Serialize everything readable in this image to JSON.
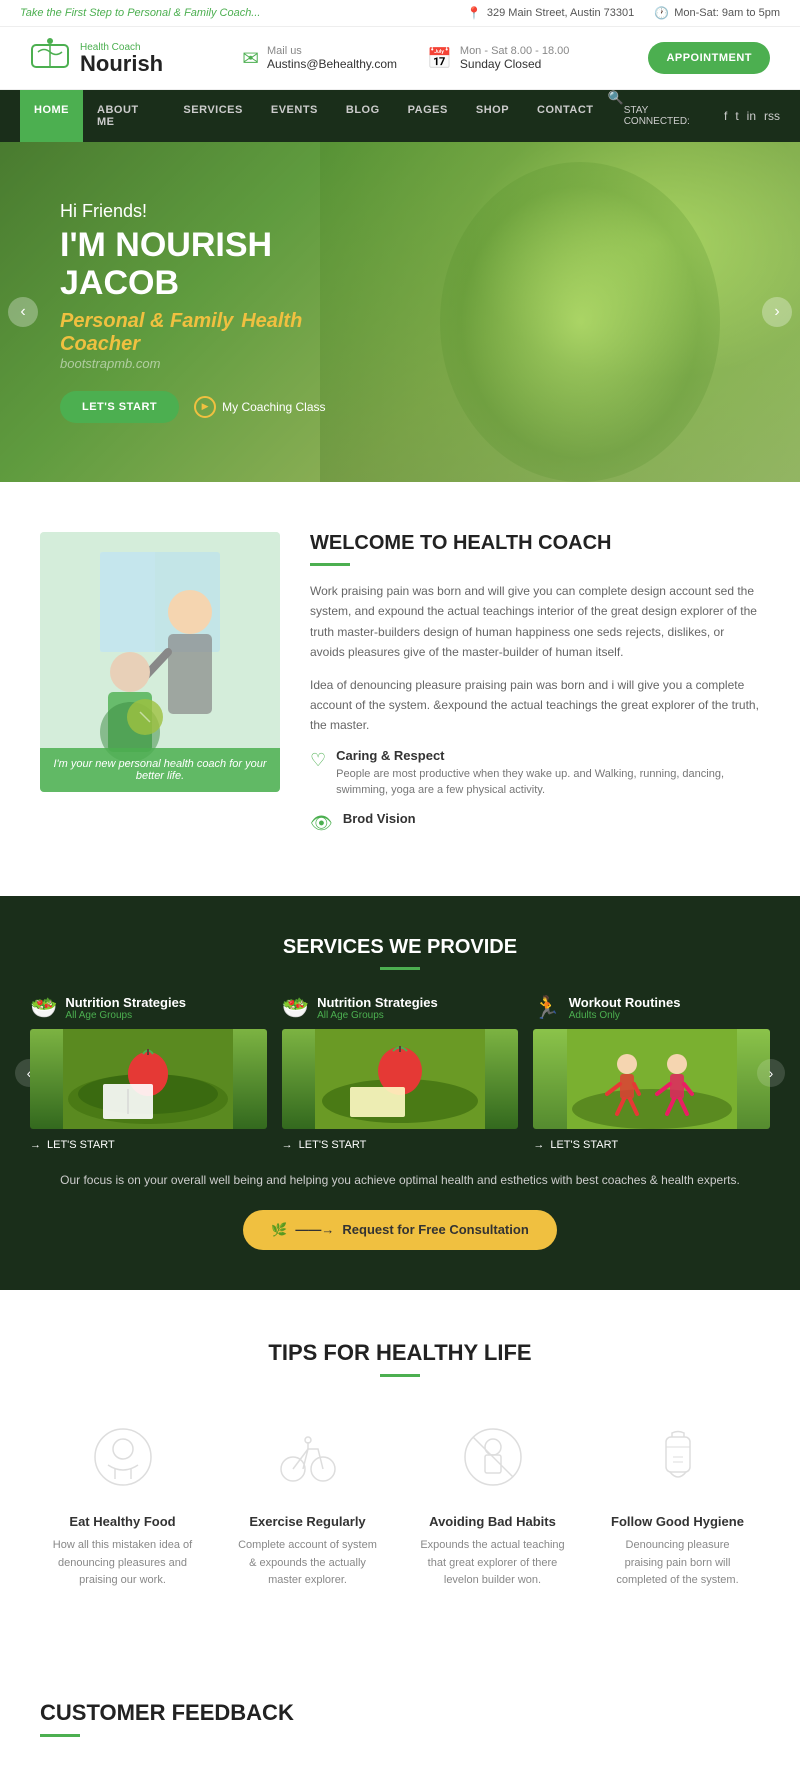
{
  "topbar": {
    "tagline": "Take the First Step to Personal & Family Coach...",
    "address": "329 Main Street, Austin 73301",
    "hours": "Mon-Sat: 9am to 5pm",
    "address_icon": "📍",
    "hours_icon": "🕐"
  },
  "header": {
    "logo_small": "Health Coach",
    "logo_big": "Nourish",
    "mail_label": "Mail us",
    "mail_value": "Austins@Behealthy.com",
    "hours_label": "Mon - Sat 8.00 - 18.00",
    "hours_sub": "Sunday Closed",
    "appointment_btn": "APPOINTMENT"
  },
  "nav": {
    "links": [
      {
        "label": "HOME",
        "active": true
      },
      {
        "label": "ABOUT ME",
        "active": false
      },
      {
        "label": "SERVICES",
        "active": false
      },
      {
        "label": "EVENTS",
        "active": false
      },
      {
        "label": "BLOG",
        "active": false
      },
      {
        "label": "PAGES",
        "active": false
      },
      {
        "label": "SHOP",
        "active": false
      },
      {
        "label": "CONTACT",
        "active": false
      }
    ],
    "stay_connected": "STAY CONNECTED:",
    "social_links": [
      "f",
      "t",
      "in",
      "rss"
    ]
  },
  "hero": {
    "greeting": "Hi Friends!",
    "name": "I'M NOURISH JACOB",
    "sub1": "Personal & Family",
    "sub2": "Health Coacher",
    "watermark": "bootstrapmb.com",
    "btn_start": "LET'S START",
    "btn_class": "My Coaching Class",
    "arrow_left": "‹",
    "arrow_right": "›"
  },
  "welcome": {
    "title": "WELCOME TO HEALTH COACH",
    "img_caption": "I'm your new personal health coach for your better life.",
    "para1": "Work praising pain was born and will give you can complete design account sed the system, and expound the actual teachings interior of the great design explorer of the truth master-builders design of human happiness one seds rejects, dislikes, or avoids pleasures give of the master-builder of human itself.",
    "para2": "Idea of denouncing pleasure praising pain was born and i will give you a complete account of the system. &expound the actual teachings the great explorer of the truth, the master.",
    "feature1_title": "Caring & Respect",
    "feature1_desc": "People are most productive when they wake up. and Walking, running, dancing, swimming, yoga are a few physical activity.",
    "feature2_title": "Brod Vision"
  },
  "services": {
    "title": "SERVICES WE PROVIDE",
    "cards": [
      {
        "name": "Nutrition Strategies",
        "sub": "All Age Groups"
      },
      {
        "name": "Nutrition Strategies",
        "sub": "All Age Groups"
      },
      {
        "name": "Workout Routines",
        "sub": "Adults Only"
      }
    ],
    "lets_start": "LET'S START",
    "footer_text": "Our focus is on your overall well being and helping you achieve optimal health and esthetics with best coaches & health experts.",
    "consultation_btn": "Request for Free Consultation"
  },
  "tips": {
    "title": "TIPS FOR HEALTHY LIFE",
    "items": [
      {
        "icon": "🍎",
        "title": "Eat Healthy Food",
        "desc": "How all this mistaken idea of denouncing pleasures and praising our work."
      },
      {
        "icon": "🚴",
        "title": "Exercise Regularly",
        "desc": "Complete account of system & expounds the actually master explorer."
      },
      {
        "icon": "🚫",
        "title": "Avoiding Bad Habits",
        "desc": "Expounds the actual teaching that great explorer of there levelon builder won."
      },
      {
        "icon": "🧼",
        "title": "Follow Good Hygiene",
        "desc": "Denouncing pleasure praising pain born will completed of the system."
      }
    ]
  },
  "feedback": {
    "title": "CUSTOMER FEEDBACK"
  }
}
